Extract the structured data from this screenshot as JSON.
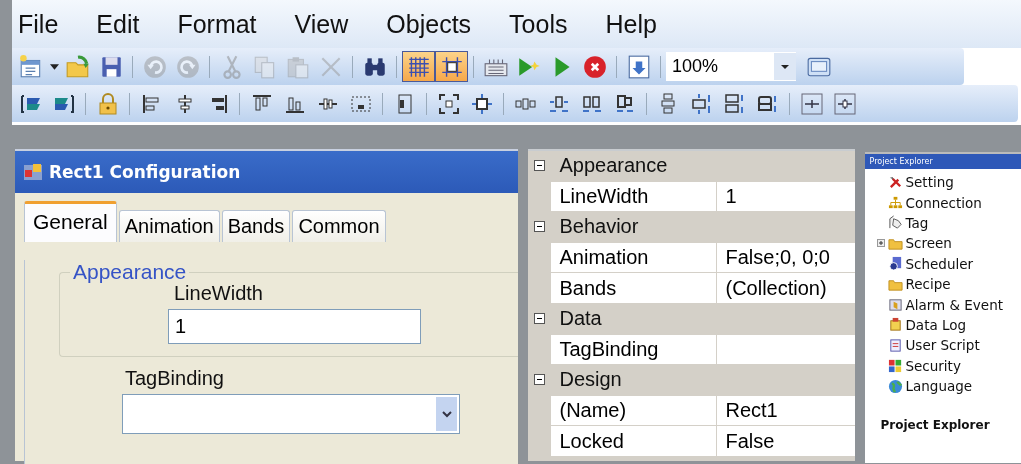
{
  "menu": [
    "File",
    "Edit",
    "Format",
    "View",
    "Objects",
    "Tools",
    "Help"
  ],
  "toolbar_standard": [
    {
      "kind": "new",
      "disabled": false,
      "on": false
    },
    {
      "kind": "caret",
      "disabled": false,
      "on": false
    },
    {
      "kind": "open",
      "disabled": false,
      "on": false
    },
    {
      "kind": "save",
      "disabled": false,
      "on": false
    },
    {
      "kind": "sep"
    },
    {
      "kind": "undo",
      "disabled": true,
      "on": false
    },
    {
      "kind": "redo",
      "disabled": true,
      "on": false
    },
    {
      "kind": "sep"
    },
    {
      "kind": "cut",
      "disabled": true,
      "on": false
    },
    {
      "kind": "copy",
      "disabled": true,
      "on": false
    },
    {
      "kind": "paste",
      "disabled": true,
      "on": false
    },
    {
      "kind": "delete",
      "disabled": true,
      "on": false
    },
    {
      "kind": "sep"
    },
    {
      "kind": "find",
      "disabled": false,
      "on": false
    },
    {
      "kind": "sep"
    },
    {
      "kind": "grid",
      "disabled": false,
      "on": true
    },
    {
      "kind": "snap",
      "disabled": false,
      "on": true
    },
    {
      "kind": "sep"
    },
    {
      "kind": "keyboard",
      "disabled": false,
      "on": false
    },
    {
      "kind": "simulate",
      "disabled": false,
      "on": false
    },
    {
      "kind": "run",
      "disabled": false,
      "on": false
    },
    {
      "kind": "stop",
      "disabled": false,
      "on": false
    },
    {
      "kind": "sep"
    },
    {
      "kind": "download",
      "disabled": false,
      "on": false
    },
    {
      "kind": "sep"
    },
    {
      "kind": "zoom",
      "value": "100%"
    },
    {
      "kind": "window",
      "disabled": false,
      "on": false
    }
  ],
  "toolbar_layout": [
    {
      "kind": "front"
    },
    {
      "kind": "back"
    },
    {
      "kind": "sep"
    },
    {
      "kind": "lock"
    },
    {
      "kind": "sep"
    },
    {
      "kind": "alignleft"
    },
    {
      "kind": "aligncenter"
    },
    {
      "kind": "alignright"
    },
    {
      "kind": "sep"
    },
    {
      "kind": "aligntop"
    },
    {
      "kind": "alignbottom"
    },
    {
      "kind": "alignmiddle"
    },
    {
      "kind": "fitwidth"
    },
    {
      "kind": "sep"
    },
    {
      "kind": "fitheight"
    },
    {
      "kind": "sep"
    },
    {
      "kind": "centerboth"
    },
    {
      "kind": "centerhoriz"
    },
    {
      "kind": "sep"
    },
    {
      "kind": "hspaceequal"
    },
    {
      "kind": "hspacemore"
    },
    {
      "kind": "hspaceless"
    },
    {
      "kind": "hspacenone"
    },
    {
      "kind": "sep"
    },
    {
      "kind": "vspaceequal"
    },
    {
      "kind": "vspacemore"
    },
    {
      "kind": "vspaceless"
    },
    {
      "kind": "vspacenone"
    },
    {
      "kind": "sep"
    },
    {
      "kind": "centerv"
    },
    {
      "kind": "centerh"
    }
  ],
  "dialog": {
    "title": "Rect1 Configuration",
    "tabs": [
      {
        "label": "General",
        "selected": true
      },
      {
        "label": "Animation",
        "selected": false
      },
      {
        "label": "Bands",
        "selected": false
      },
      {
        "label": "Common",
        "selected": false
      }
    ],
    "group": "Appearance",
    "linewidth_label": "LineWidth",
    "linewidth_value": "1",
    "tagbinding_label": "TagBinding"
  },
  "properties": [
    {
      "category": "Appearance",
      "expanded": true,
      "rows": [
        {
          "name": "LineWidth",
          "value": "1"
        }
      ]
    },
    {
      "category": "Behavior",
      "expanded": true,
      "rows": [
        {
          "name": "Animation",
          "value": "False;0, 0;0"
        },
        {
          "name": "Bands",
          "value": "(Collection)"
        }
      ]
    },
    {
      "category": "Data",
      "expanded": true,
      "rows": [
        {
          "name": "TagBinding",
          "value": ""
        }
      ]
    },
    {
      "category": "Design",
      "expanded": true,
      "rows": [
        {
          "name": "(Name)",
          "value": "Rect1"
        },
        {
          "name": "Locked",
          "value": "False"
        }
      ]
    }
  ],
  "explorer": {
    "title": "Project Explorer",
    "items": [
      {
        "label": "Setting",
        "kind": "setting"
      },
      {
        "label": "Connection",
        "kind": "connection"
      },
      {
        "label": "Tag",
        "kind": "tag"
      },
      {
        "label": "Screen",
        "kind": "folder",
        "expanded": false
      },
      {
        "label": "Scheduler",
        "kind": "scheduler"
      },
      {
        "label": "Recipe",
        "kind": "folder"
      },
      {
        "label": "Alarm & Event",
        "kind": "alarm"
      },
      {
        "label": "Data Log",
        "kind": "datalog"
      },
      {
        "label": "User Script",
        "kind": "script"
      },
      {
        "label": "Security",
        "kind": "security"
      },
      {
        "label": "Language",
        "kind": "language"
      }
    ],
    "footer": "Project Explorer"
  }
}
